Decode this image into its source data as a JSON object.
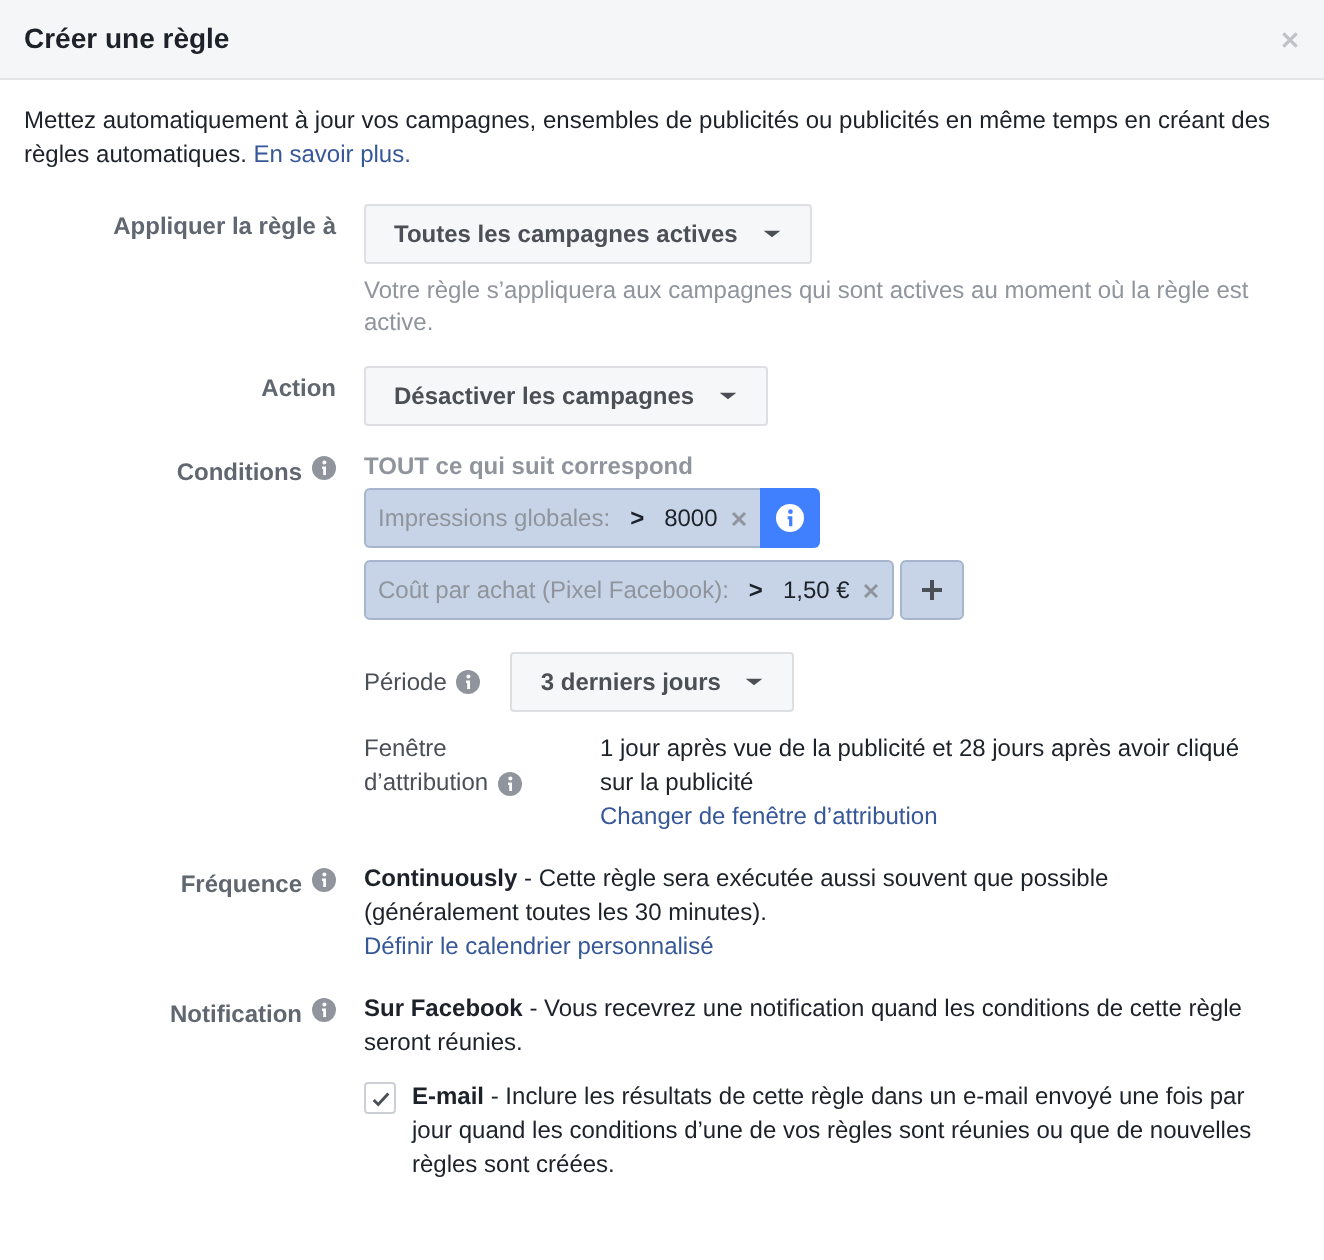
{
  "dialog": {
    "title": "Créer une règle"
  },
  "intro": {
    "text": "Mettez automatiquement à jour vos campagnes, ensembles de publicités ou publicités en même temps en créant des règles automatiques.",
    "link": "En savoir plus."
  },
  "apply": {
    "label": "Appliquer la règle à",
    "dropdown": "Toutes les campagnes actives",
    "help": "Votre règle s’appliquera aux campagnes qui sont actives au moment où la règle est active."
  },
  "action": {
    "label": "Action",
    "dropdown": "Désactiver les campagnes"
  },
  "conditions": {
    "label": "Conditions",
    "match_text": "TOUT ce qui suit correspond",
    "items": [
      {
        "metric": "Impressions globales:",
        "operator": ">",
        "value": "8000",
        "kind": "info"
      },
      {
        "metric": "Coût par achat (Pixel Facebook):",
        "operator": ">",
        "value": "1,50 €",
        "kind": "add"
      }
    ],
    "period": {
      "label": "Période",
      "dropdown": "3 derniers jours"
    },
    "attribution": {
      "label_line1": "Fenêtre",
      "label_line2": "d’attribution",
      "text": "1 jour après vue de la publicité et 28 jours après avoir cliqué sur la publicité",
      "link": "Changer de fenêtre d’attribution"
    }
  },
  "frequency": {
    "label": "Fréquence",
    "text": "**Continuously** - Cette règle sera exécutée aussi souvent que possible (généralement toutes les 30 minutes).",
    "link": "Définir le calendrier personnalisé"
  },
  "notification": {
    "label": "Notification",
    "text": "**Sur Facebook** - Vous recevrez une notification quand les conditions de cette règle seront réunies.",
    "email": {
      "checked": true,
      "text": "**E-mail** - Inclure les résultats de cette règle dans un e-mail envoyé une fois par jour quand les conditions d’une de vos règles sont réunies ou que de nouvelles règles sont créées."
    }
  }
}
